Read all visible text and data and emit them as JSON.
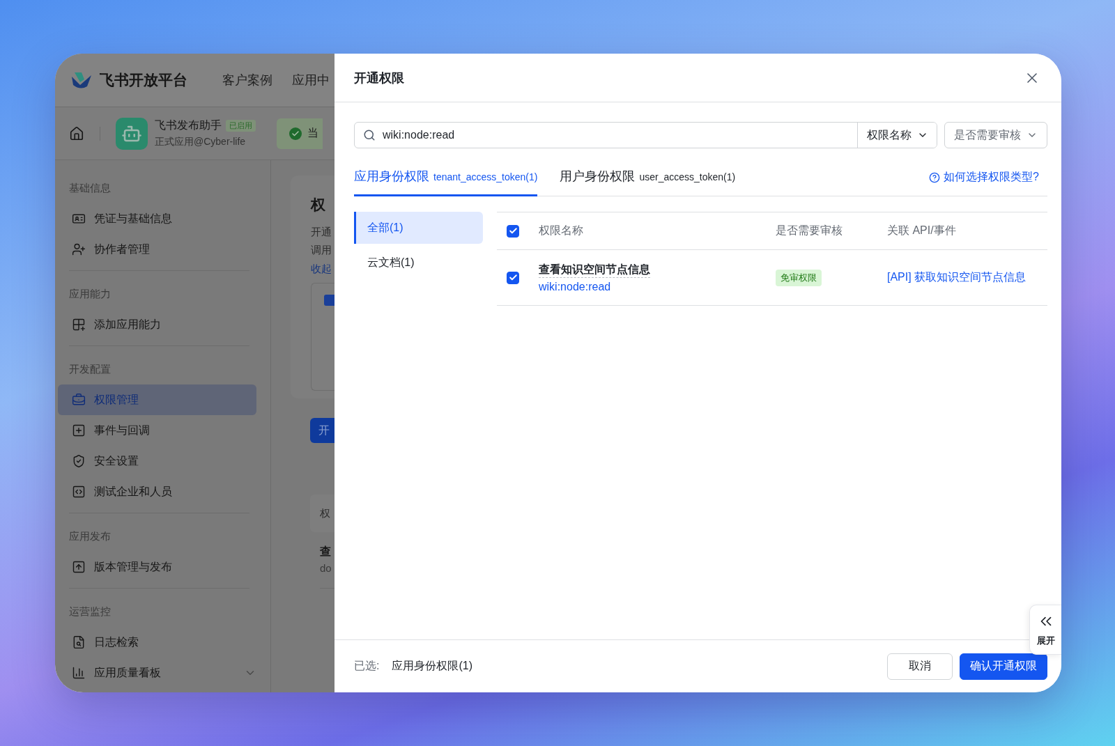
{
  "background_app": {
    "logo_text": "飞书开放平台",
    "nav": [
      "客户案例",
      "应用中"
    ],
    "app": {
      "name": "飞书发布助手",
      "badge": "已启用",
      "subtitle": "正式应用@Cyber-life",
      "status_text": "当"
    },
    "sidebar": [
      {
        "title": "基础信息",
        "items": [
          {
            "label": "凭证与基础信息",
            "selected": false,
            "kind": "link"
          },
          {
            "label": "协作者管理",
            "selected": false,
            "kind": "link"
          }
        ]
      },
      {
        "title": "应用能力",
        "items": [
          {
            "label": "添加应用能力",
            "selected": false,
            "kind": "link"
          }
        ]
      },
      {
        "title": "开发配置",
        "items": [
          {
            "label": "权限管理",
            "selected": true,
            "kind": "link"
          },
          {
            "label": "事件与回调",
            "selected": false,
            "kind": "link"
          },
          {
            "label": "安全设置",
            "selected": false,
            "kind": "link"
          },
          {
            "label": "测试企业和人员",
            "selected": false,
            "kind": "link"
          }
        ]
      },
      {
        "title": "应用发布",
        "items": [
          {
            "label": "版本管理与发布",
            "selected": false,
            "kind": "link"
          }
        ]
      },
      {
        "title": "运营监控",
        "items": [
          {
            "label": "日志检索",
            "selected": false,
            "kind": "link"
          },
          {
            "label": "应用质量看板",
            "selected": false,
            "kind": "group"
          }
        ]
      }
    ],
    "content": {
      "heading": "权",
      "lines": [
        "开通",
        "调用"
      ],
      "link": "收起",
      "button": "开",
      "table_header": "权",
      "row_title": "查",
      "row_sub": "do"
    }
  },
  "dialog": {
    "title": "开通权限",
    "search": {
      "value": "wiki:node:read"
    },
    "filters": [
      {
        "label": "权限名称",
        "kind": "attached"
      },
      {
        "label": "是否需要审核",
        "kind": "standalone"
      }
    ],
    "tabs": [
      {
        "label": "应用身份权限",
        "token": "tenant_access_token(1)",
        "selected": true
      },
      {
        "label": "用户身份权限",
        "token": "user_access_token(1)",
        "selected": false
      }
    ],
    "help_link": "如何选择权限类型?",
    "categories": [
      {
        "label": "全部(1)",
        "selected": true
      },
      {
        "label": "云文档(1)",
        "selected": false
      }
    ],
    "table": {
      "all_checked": true,
      "columns": [
        "权限名称",
        "是否需要审核",
        "关联 API/事件"
      ],
      "rows": [
        {
          "checked": true,
          "name": "查看知识空间节点信息",
          "scope": "wiki:node:read",
          "review": "免审权限",
          "api": "[API] 获取知识空间节点信息"
        }
      ]
    },
    "footer": {
      "selected_label": "已选:",
      "selected_value": "应用身份权限(1)",
      "buttons": [
        {
          "label": "取消",
          "kind": "secondary"
        },
        {
          "label": "确认开通权限",
          "kind": "primary"
        }
      ]
    },
    "expand_tab": {
      "label": "展开"
    }
  }
}
